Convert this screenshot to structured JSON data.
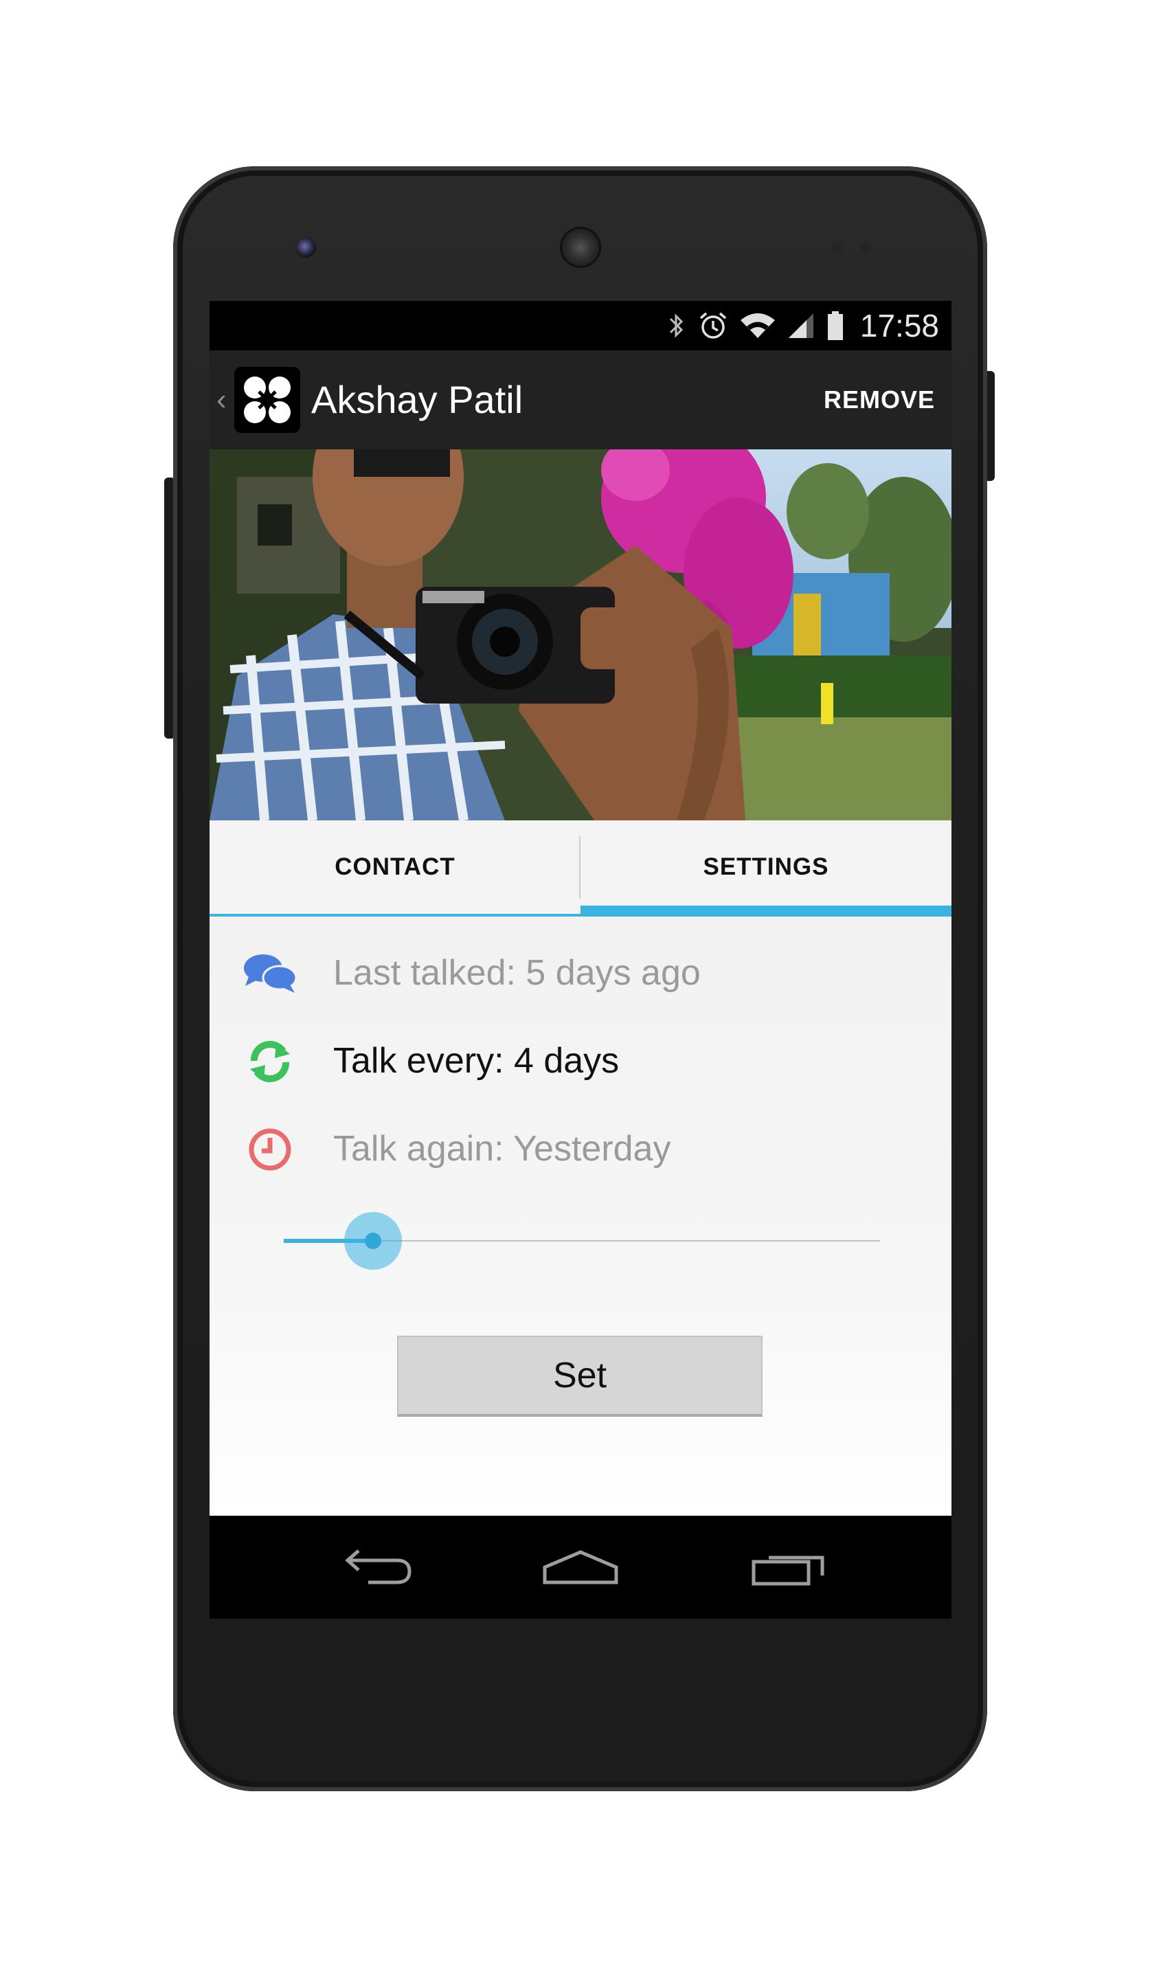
{
  "status_bar": {
    "time": "17:58",
    "icons": [
      "bluetooth-icon",
      "alarm-icon",
      "wifi-icon",
      "signal-icon",
      "battery-icon"
    ]
  },
  "action_bar": {
    "title": "Akshay Patil",
    "remove_label": "REMOVE"
  },
  "tabs": [
    {
      "label": "CONTACT",
      "selected": false
    },
    {
      "label": "SETTINGS",
      "selected": true
    }
  ],
  "settings": {
    "last_talked": "Last talked: 5 days ago",
    "talk_every": "Talk every: 4 days",
    "talk_again": "Talk again: Yesterday",
    "slider_fraction": 0.15,
    "set_label": "Set"
  },
  "colors": {
    "accent": "#3bb3e2",
    "chat_icon": "#4a7fe0",
    "refresh_icon": "#3cc15b",
    "clock_icon": "#ea6b6b"
  }
}
